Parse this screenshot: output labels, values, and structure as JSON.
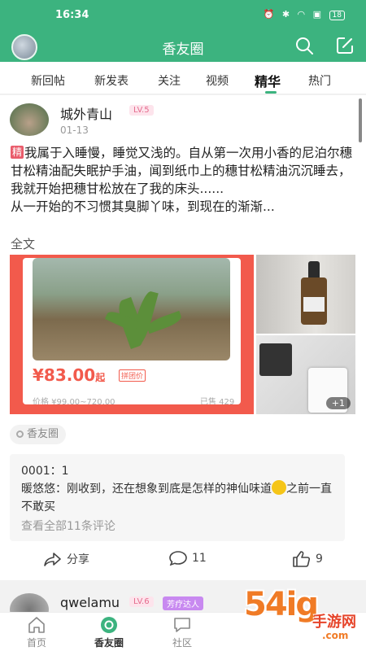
{
  "status_bar": {
    "time": "16:34",
    "battery": "18"
  },
  "app_bar": {
    "title": "香友圈"
  },
  "tabs": [
    {
      "label": "新回帖",
      "active": false
    },
    {
      "label": "新发表",
      "active": false
    },
    {
      "label": "关注",
      "active": false
    },
    {
      "label": "视频",
      "active": false
    },
    {
      "label": "精华",
      "active": true
    },
    {
      "label": "热门",
      "active": false
    }
  ],
  "post": {
    "username": "城外青山",
    "level": "LV.5",
    "date": "01-13",
    "tag": "精",
    "body": "我属于入睡慢，睡觉又浅的。自从第一次用小香的尼泊尔穗甘松精油配失眠护手油，闻到纸巾上的穗甘松精油沉沉睡去，我就开始把穗甘松放在了我的床头......",
    "body2": "从一开始的不习惯其臭脚丫味，到现在的渐渐...",
    "fulltext_label": "全文",
    "product": {
      "price_symbol": "¥",
      "price": "83.00",
      "price_suffix": "起",
      "group_tag": "拼团价",
      "old_price": "价格 ¥99.00~720.00",
      "sold": "已售 429"
    },
    "more_images": "+1",
    "topic": "香友圈",
    "comments": [
      {
        "name": "0001：",
        "text": "1"
      },
      {
        "name": "暖悠悠：",
        "text": "刚收到，还在想象到底是怎样的神仙味道",
        "text2": "之前一直不敢买"
      }
    ],
    "view_all": "查看全部11条评论",
    "share_label": "分享",
    "comment_count": "11",
    "like_count": "9"
  },
  "post2": {
    "username": "qwelamu",
    "level": "LV.6",
    "badge": "芳疗达人"
  },
  "bottom_nav": [
    {
      "label": "首页",
      "active": false
    },
    {
      "label": "香友圈",
      "active": true
    },
    {
      "label": "社区",
      "active": false
    }
  ],
  "watermark": {
    "main": "54ig",
    "sub": "手游网",
    "url": ".com"
  },
  "colors": {
    "accent": "#3cb37f",
    "price": "#f25a4c",
    "level": "#e56c8e"
  }
}
